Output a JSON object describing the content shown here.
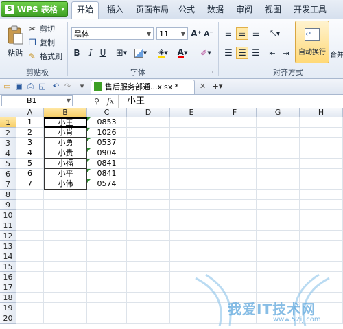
{
  "app": {
    "name": "WPS 表格",
    "colors": {
      "accent_green": "#3d9f24",
      "selection": "#f7cf6a"
    }
  },
  "menu": [
    "开始",
    "插入",
    "页面布局",
    "公式",
    "数据",
    "审阅",
    "视图",
    "开发工具"
  ],
  "ribbon": {
    "paste_label": "粘贴",
    "cut_label": "剪切",
    "copy_label": "复制",
    "format_painter_label": "格式刷",
    "clipboard_group": "剪贴板",
    "font_name": "黑体",
    "font_size": "11",
    "font_group": "字体",
    "bold": "B",
    "italic": "I",
    "underline": "U",
    "grow_font": "A⁺",
    "shrink_font": "A⁻",
    "wrap_label": "自动换行",
    "merge_label": "合并",
    "align_group": "对齐方式"
  },
  "doc": {
    "tab_title": "售后服务部通...xlsx *"
  },
  "formula_bar": {
    "name_box": "B1",
    "content": "小王"
  },
  "sheet": {
    "columns": [
      "A",
      "B",
      "C",
      "D",
      "E",
      "F",
      "G",
      "H"
    ],
    "rows": [
      "1",
      "2",
      "3",
      "4",
      "5",
      "6",
      "7",
      "8",
      "9",
      "10",
      "11",
      "12",
      "13",
      "14",
      "15",
      "16",
      "17",
      "18",
      "19",
      "20"
    ],
    "data": [
      [
        "1",
        "小王",
        "0853"
      ],
      [
        "2",
        "小肖",
        "1026"
      ],
      [
        "3",
        "小勇",
        "0537"
      ],
      [
        "4",
        "小贵",
        "0904"
      ],
      [
        "5",
        "小福",
        "0841"
      ],
      [
        "6",
        "小平",
        "0841"
      ],
      [
        "7",
        "小伟",
        "0574"
      ]
    ]
  },
  "watermark": {
    "text": "我爱IT技术网",
    "sub": "www.52ij.com"
  }
}
